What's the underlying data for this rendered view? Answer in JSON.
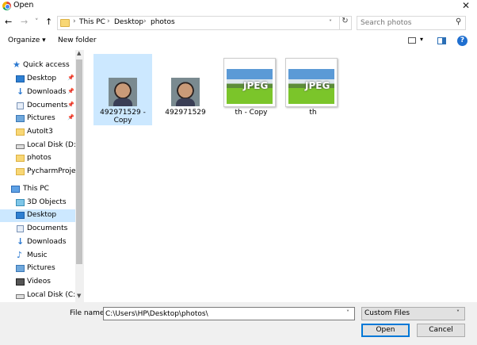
{
  "window": {
    "title": "Open",
    "close_glyph": "✕"
  },
  "nav": {
    "back": "←",
    "forward": "→",
    "recent": "˅",
    "up": "↑"
  },
  "address": {
    "breadcrumbs": [
      "This PC",
      "Desktop",
      "photos"
    ],
    "separator": "›",
    "dropdown": "˅",
    "refresh": "↻"
  },
  "search": {
    "placeholder": "Search photos",
    "icon": "⚲"
  },
  "toolbar": {
    "organize": "Organize ▾",
    "new_folder": "New folder",
    "help": "?",
    "view_drop": "▾"
  },
  "sidebar": {
    "items": [
      {
        "label": "Quick access",
        "icon": "star"
      },
      {
        "label": "Desktop",
        "icon": "desktop",
        "pinned": true
      },
      {
        "label": "Downloads",
        "icon": "down",
        "pinned": true
      },
      {
        "label": "Documents",
        "icon": "docs",
        "pinned": true
      },
      {
        "label": "Pictures",
        "icon": "pics",
        "pinned": true
      },
      {
        "label": "AutoIt3",
        "icon": "folder"
      },
      {
        "label": "Local Disk (D:)",
        "icon": "disk"
      },
      {
        "label": "photos",
        "icon": "folder"
      },
      {
        "label": "PycharmProjects",
        "icon": "folder"
      },
      {
        "label": "This PC",
        "icon": "pc"
      },
      {
        "label": "3D Objects",
        "icon": "3d"
      },
      {
        "label": "Desktop",
        "icon": "desktop",
        "selected": true
      },
      {
        "label": "Documents",
        "icon": "docs"
      },
      {
        "label": "Downloads",
        "icon": "down"
      },
      {
        "label": "Music",
        "icon": "music"
      },
      {
        "label": "Pictures",
        "icon": "pics"
      },
      {
        "label": "Videos",
        "icon": "video"
      },
      {
        "label": "Local Disk (C:)",
        "icon": "disk"
      }
    ],
    "pin_glyph": "📌"
  },
  "files": [
    {
      "name_line1": "492971529 -",
      "name_line2": "Copy",
      "kind": "photo",
      "selected": true
    },
    {
      "name_line1": "492971529",
      "name_line2": "",
      "kind": "photo"
    },
    {
      "name_line1": "th - Copy",
      "name_line2": "",
      "kind": "jpeg",
      "badge": "JPEG"
    },
    {
      "name_line1": "th",
      "name_line2": "",
      "kind": "jpeg",
      "badge": "JPEG"
    }
  ],
  "bottom": {
    "file_name_label": "File name:",
    "file_name_value": "C:\\Users\\HP\\Desktop\\photos\\",
    "file_type": "Custom Files",
    "open_label": "Open",
    "cancel_label": "Cancel",
    "drop": "˅"
  }
}
